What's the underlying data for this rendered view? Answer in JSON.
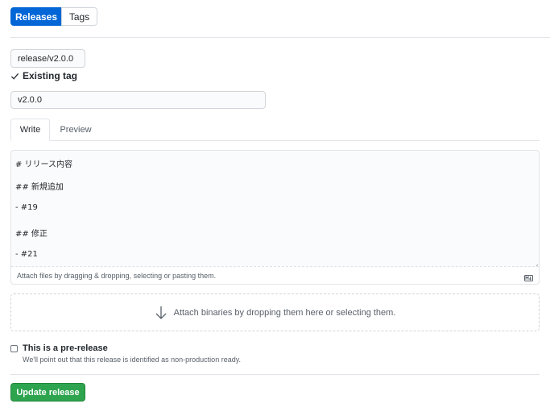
{
  "nav": {
    "releases_label": "Releases",
    "tags_label": "Tags"
  },
  "tag": {
    "value": "release/v2.0.0",
    "status": "Existing tag"
  },
  "title": {
    "value": "v2.0.0"
  },
  "editor": {
    "tabs": [
      "Write",
      "Preview"
    ],
    "active_tab": "Write",
    "lines": [
      "# リリース内容",
      "## 新規追加",
      "- #19",
      "## 修正",
      "- #21"
    ],
    "attach_hint": "Attach files by dragging & dropping, selecting or pasting them."
  },
  "binaries": {
    "label": "Attach binaries by dropping them here or selecting them."
  },
  "prerelease": {
    "checked": false,
    "label": "This is a pre-release",
    "note": "We'll point out that this release is identified as non-production ready."
  },
  "submit": {
    "label": "Update release"
  },
  "icons": [
    "check-icon",
    "markdown-icon",
    "resize-handle-icon",
    "arrow-down-icon"
  ],
  "colors": {
    "primary_blue": "#0366d6",
    "success_green": "#2ea44f",
    "border": "#e1e4e8",
    "muted_text": "#586069"
  }
}
